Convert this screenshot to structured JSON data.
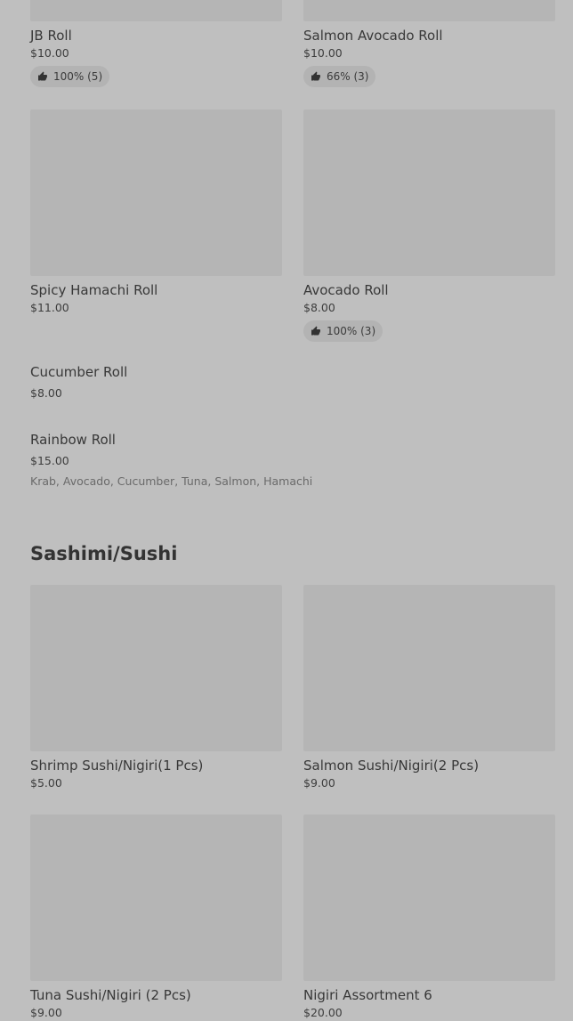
{
  "rolls_top": [
    {
      "name": "JB Roll",
      "price": "$10.00",
      "rating": "100% (5)"
    },
    {
      "name": "Salmon Avocado Roll",
      "price": "$10.00",
      "rating": "66% (3)"
    }
  ],
  "rolls_mid": [
    {
      "name": "Spicy Hamachi Roll",
      "price": "$11.00"
    },
    {
      "name": "Avocado Roll",
      "price": "$8.00",
      "rating": "100% (3)"
    }
  ],
  "list_items": [
    {
      "name": "Cucumber Roll",
      "price": "$8.00"
    },
    {
      "name": "Rainbow Roll",
      "price": "$15.00",
      "description": "Krab, Avocado, Cucumber, Tuna, Salmon, Hamachi"
    }
  ],
  "sashimi_section": {
    "title": "Sashimi/Sushi",
    "items": [
      {
        "name": "Shrimp Sushi/Nigiri(1 Pcs)",
        "price": "$5.00"
      },
      {
        "name": "Salmon Sushi/Nigiri(2 Pcs)",
        "price": "$9.00"
      },
      {
        "name": "Tuna Sushi/Nigiri (2 Pcs)",
        "price": "$9.00"
      },
      {
        "name": "Nigiri Assortment 6",
        "price": "$20.00"
      }
    ]
  },
  "icons": {
    "rating": "thumbs-up-icon"
  }
}
